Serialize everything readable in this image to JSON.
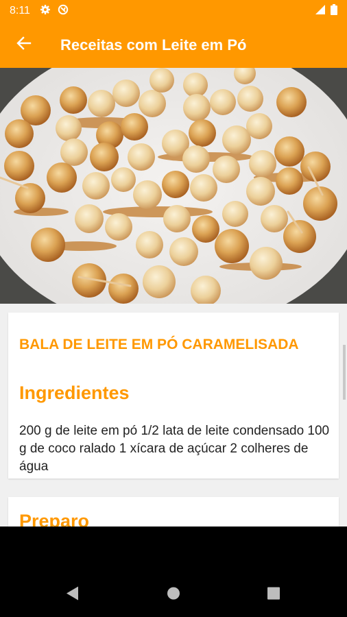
{
  "status_bar": {
    "time": "8:11",
    "icons": [
      "settings-icon",
      "sync-icon",
      "signal-icon",
      "battery-icon"
    ]
  },
  "app_bar": {
    "title": "Receitas com Leite em Pó",
    "back_icon": "arrow-left-icon",
    "background": "#ff9800"
  },
  "recipe": {
    "title": "BALA DE LEITE EM PÓ CARAMELISADA",
    "ingredients_heading": "Ingredientes",
    "ingredients_text": " 200 g de leite em pó 1/2 lata de leite condensado 100 g de coco ralado 1 xícara de açúcar 2 colheres de água",
    "preparation_heading": "Preparo"
  },
  "nav_bar": {
    "buttons": [
      "back-triangle-icon",
      "home-circle-icon",
      "recents-square-icon"
    ]
  },
  "colors": {
    "accent": "#ff9800",
    "text": "#222222",
    "nav": "#000000"
  }
}
